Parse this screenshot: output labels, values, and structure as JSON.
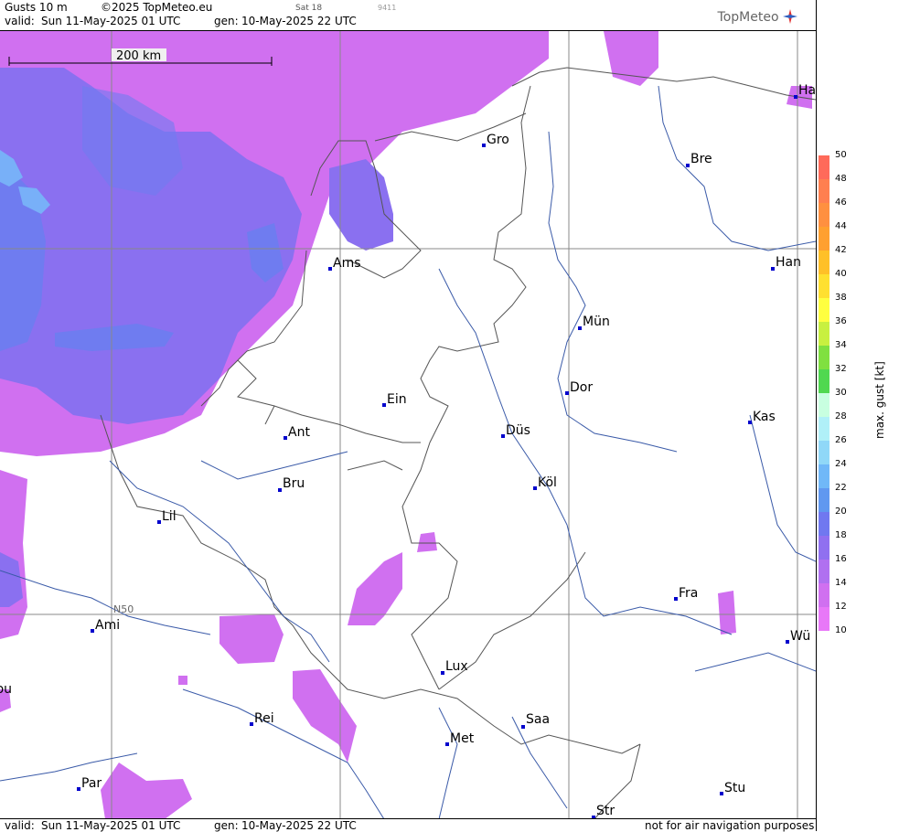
{
  "header": {
    "product": "Gusts 10 m",
    "copyright": "©2025 TopMeteo.eu",
    "valid_label": "valid:",
    "valid_time": "Sun  11-May-2025  01 UTC",
    "gen_label": "gen:",
    "gen_time": "10-May-2025 22 UTC",
    "sat_label": "Sat 18",
    "code": "9411",
    "brand": "TopMeteo"
  },
  "map": {
    "scale_label": "200 km",
    "lat_label": "N50",
    "cities": [
      "Ha",
      "Gro",
      "Bre",
      "Ams",
      "Han",
      "Mün",
      "Dor",
      "Ein",
      "Kas",
      "Ant",
      "Düs",
      "Köl",
      "Bru",
      "Lil",
      "Fra",
      "Ami",
      "Wü",
      "Lux",
      "Bou",
      "Rei",
      "Saa",
      "Met",
      "Stu",
      "Par",
      "Str"
    ]
  },
  "footer": {
    "valid_label": "valid:",
    "valid_time": "Sun  11-May-2025  01 UTC",
    "gen_label": "gen:",
    "gen_time": "10-May-2025 22 UTC",
    "disclaimer": "not for air navigation purposes"
  },
  "legend": {
    "title": "max. gust [kt]",
    "ticks": [
      "50",
      "48",
      "46",
      "44",
      "42",
      "40",
      "38",
      "36",
      "34",
      "32",
      "30",
      "28",
      "26",
      "24",
      "22",
      "20",
      "18",
      "16",
      "14",
      "12",
      "10"
    ],
    "colors": [
      "#ff6a5a",
      "#ff7f50",
      "#ff9040",
      "#ffa030",
      "#ffc028",
      "#ffe030",
      "#ffff40",
      "#c8f040",
      "#80e040",
      "#50d850",
      "#c8ffe0",
      "#b0f0f8",
      "#90d8f8",
      "#70b8f8",
      "#6098f0",
      "#7078f0",
      "#9070f0",
      "#b070f0",
      "#d070f0",
      "#e878f8"
    ]
  }
}
